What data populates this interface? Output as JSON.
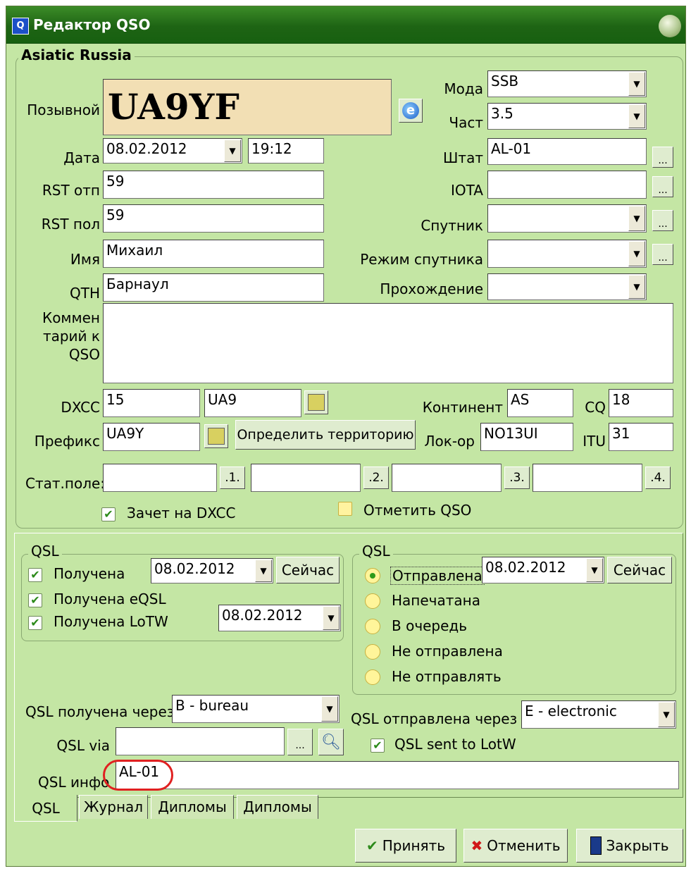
{
  "window": {
    "title": "Редактор QSO",
    "app_icon": "Q"
  },
  "country": "Asiatic Russia",
  "fields": {
    "callsign_label": "Позывной",
    "callsign": "UA9YF",
    "date_label": "Дата",
    "date": "08.02.2012",
    "time": "19:12",
    "rst_sent_label": "RST отп",
    "rst_sent": "59",
    "rst_rcvd_label": "RST пол",
    "rst_rcvd": "59",
    "name_label": "Имя",
    "name": "Михаил",
    "qth_label": "QTH",
    "qth": "Барнаул",
    "comment_label_1": "Коммен",
    "comment_label_2": "тарий к",
    "comment_label_3": "QSO",
    "comment": "",
    "mode_label": "Мода",
    "mode": "SSB",
    "freq_label": "Част",
    "freq": "3.5",
    "state_label": "Штат",
    "state": "AL-01",
    "iota_label": "IOTA",
    "iota": "",
    "sat_label": "Спутник",
    "sat": "",
    "sat_mode_label": "Режим спутника",
    "sat_mode": "",
    "prop_label": "Прохождение",
    "prop": "",
    "dxcc_label": "DXCC",
    "dxcc": "15",
    "dxcc_prefix": "UA9",
    "prefix_label": "Префикс",
    "prefix": "UA9Y",
    "detect_button": "Определить территорию",
    "continent_label": "Континент",
    "continent": "AS",
    "cq_label": "CQ",
    "cq": "18",
    "locator_label": "Лок-ор",
    "locator": "NO13UI",
    "itu_label": "ITU",
    "itu": "31",
    "stat_label": "Стат.поле:",
    "stat_buttons": [
      ".1.",
      ".2.",
      ".3.",
      ".4."
    ],
    "dxcc_credit": "Зачет на DXCC",
    "mark_qso": "Отметить QSO",
    "ellipsis": "..."
  },
  "qsl_rcvd": {
    "title": "QSL",
    "received": "Получена",
    "received_date": "08.02.2012",
    "now": "Сейчас",
    "eqsl": "Получена eQSL",
    "lotw": "Получена LoTW",
    "lotw_date": "08.02.2012"
  },
  "qsl_sent": {
    "title": "QSL",
    "options": [
      "Отправлена",
      "Напечатана",
      "В очередь",
      "Не отправлена",
      "Не отправлять"
    ],
    "selected": 0,
    "sent_date": "08.02.2012",
    "now": "Сейчас"
  },
  "qsl_bottom": {
    "via_rcvd_label": "QSL получена через",
    "via_rcvd": "B - bureau",
    "via_sent_label": "QSL отправлена через",
    "via_sent": "E - electronic",
    "qsl_via_label": "QSL via",
    "qsl_via": "",
    "lotw_sent": "QSL sent to LotW",
    "info_label": "QSL инфо",
    "info": "AL-01"
  },
  "tabs": [
    "QSL",
    "Журнал",
    "Дипломы",
    "Дипломы"
  ],
  "buttons": {
    "accept": "Принять",
    "cancel": "Отменить",
    "close": "Закрыть"
  },
  "colors": {
    "window_bg": "#c4e6a4",
    "title_bg": "#1e6414",
    "callsign_bg": "#f2dfb4",
    "highlight_ring": "#e02020"
  }
}
